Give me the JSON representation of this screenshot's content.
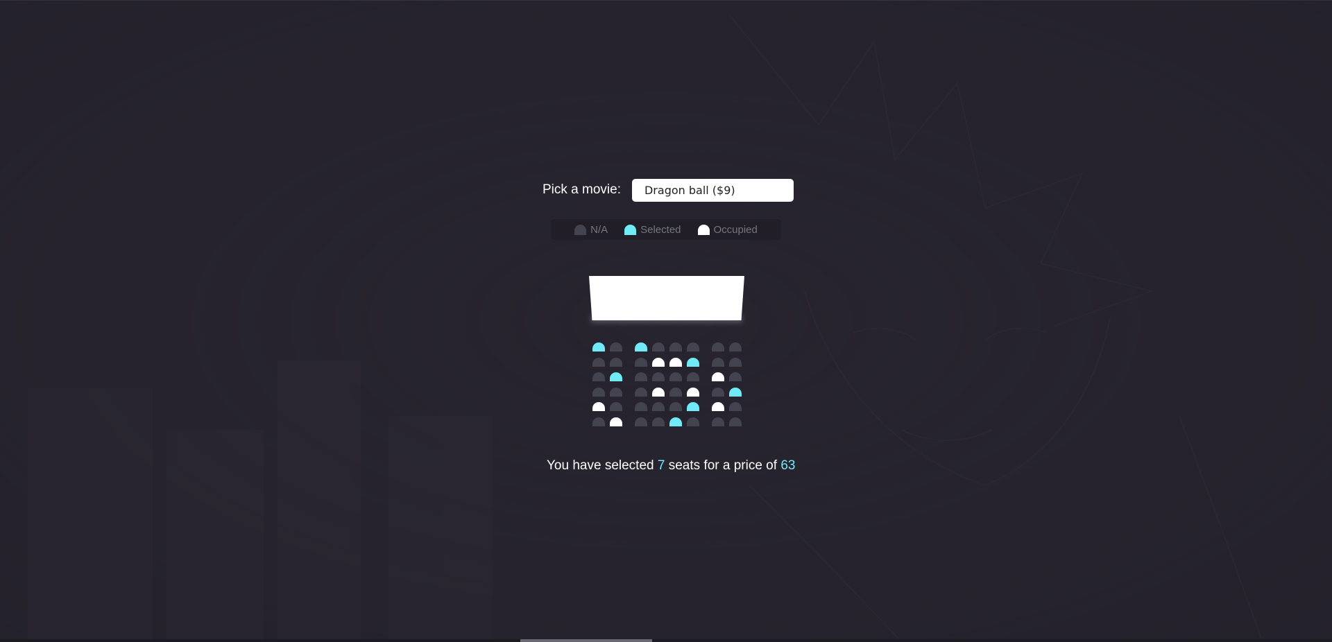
{
  "movie_picker": {
    "label": "Pick a movie:",
    "selected": "Dragon ball ($9)"
  },
  "legend": {
    "na": "N/A",
    "selected": "Selected",
    "occupied": "Occupied"
  },
  "colors": {
    "background": "#27242f",
    "seat_na": "#444451",
    "seat_selected": "#6feaf6",
    "seat_occupied": "#ffffff",
    "accent": "#6feaf6"
  },
  "seating": {
    "rows": [
      [
        "selected",
        "na",
        "selected",
        "na",
        "na",
        "na",
        "na",
        "na"
      ],
      [
        "na",
        "na",
        "na",
        "occupied",
        "occupied",
        "selected",
        "na",
        "na"
      ],
      [
        "na",
        "selected",
        "na",
        "na",
        "na",
        "na",
        "occupied",
        "na"
      ],
      [
        "na",
        "na",
        "na",
        "occupied",
        "na",
        "occupied",
        "na",
        "selected"
      ],
      [
        "occupied",
        "na",
        "na",
        "na",
        "na",
        "selected",
        "occupied",
        "na"
      ],
      [
        "na",
        "occupied",
        "na",
        "na",
        "selected",
        "na",
        "na",
        "na"
      ]
    ]
  },
  "summary": {
    "prefix": "You have selected",
    "count": "7",
    "middle": "seats for a price of",
    "total": "63"
  }
}
